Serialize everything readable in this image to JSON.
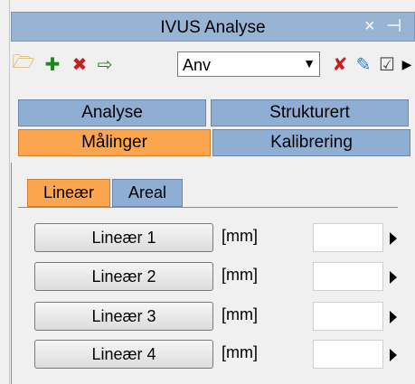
{
  "window": {
    "title": "IVUS Analyse"
  },
  "toolbar": {
    "select_value": "Anv"
  },
  "tabs_row1": [
    "Analyse",
    "Strukturert"
  ],
  "tabs_row2": [
    "Målinger",
    "Kalibrering"
  ],
  "subtabs": [
    "Lineær",
    "Areal"
  ],
  "measurements": [
    {
      "label": "Lineær 1",
      "unit": "[mm]"
    },
    {
      "label": "Lineær 2",
      "unit": "[mm]"
    },
    {
      "label": "Lineær 3",
      "unit": "[mm]"
    },
    {
      "label": "Lineær 4",
      "unit": "[mm]"
    }
  ],
  "colors": {
    "active_tab": "#fba64f",
    "inactive_tab": "#8faed4",
    "titlebar": "#98b4d4"
  }
}
